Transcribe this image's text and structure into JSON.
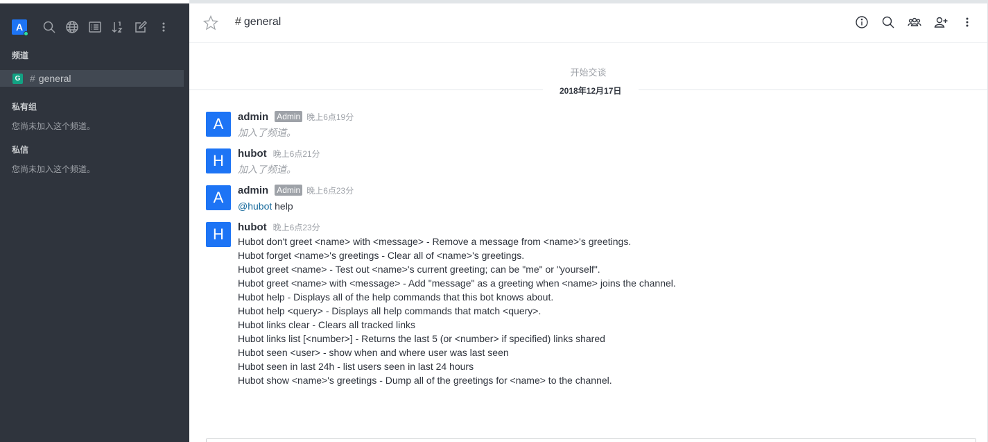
{
  "sidebar": {
    "avatar_letter": "A",
    "sections": {
      "channels": "频道",
      "private_groups": "私有组",
      "direct_messages": "私信"
    },
    "channel": {
      "icon_letter": "G",
      "name": "general"
    },
    "empty_private": "您尚未加入这个频道。",
    "empty_direct": "您尚未加入这个频道。",
    "toolbar_icons": [
      "search-icon",
      "globe-icon",
      "list-icon",
      "sort-icon",
      "edit-icon",
      "kebab-icon"
    ]
  },
  "header": {
    "room_name": "general",
    "icons": [
      "info-icon",
      "search-icon",
      "members-icon",
      "add-user-icon",
      "kebab-icon"
    ]
  },
  "conversation": {
    "start_text": "开始交谈",
    "date": "2018年12月17日"
  },
  "messages": [
    {
      "avatar": "A",
      "user": "admin",
      "role": "Admin",
      "time": "晚上6点19分",
      "text": "加入了频道。"
    },
    {
      "avatar": "H",
      "user": "hubot",
      "time": "晚上6点21分",
      "text": "加入了频道。"
    },
    {
      "avatar": "A",
      "user": "admin",
      "role": "Admin",
      "time": "晚上6点23分",
      "mention": "@hubot",
      "text": " help"
    },
    {
      "avatar": "H",
      "user": "hubot",
      "time": "晚上6点23分",
      "lines": [
        "Hubot don't greet <name> with <message> - Remove a message from <name>'s greetings.",
        "Hubot forget <name>'s greetings - Clear all of <name>'s greetings.",
        "Hubot greet <name> - Test out <name>'s current greeting; can be \"me\" or \"yourself\".",
        "Hubot greet <name> with <message> - Add \"message\" as a greeting when <name> joins the channel.",
        "Hubot help - Displays all of the help commands that this bot knows about.",
        "Hubot help <query> - Displays all help commands that match <query>.",
        "Hubot links clear - Clears all tracked links",
        "Hubot links list [<number>] - Returns the last 5 (or <number> if specified) links shared",
        "Hubot seen <user> - show when and where user was last seen",
        "Hubot seen in last 24h - list users seen in last 24 hours",
        "Hubot show <name>'s greetings - Dump all of the greetings for <name> to the channel."
      ]
    }
  ],
  "colors": {
    "sidebar_bg": "#2f343d",
    "accent": "#1d74f5",
    "channel_badge": "#12a283",
    "status_online": "#2de0a5"
  }
}
